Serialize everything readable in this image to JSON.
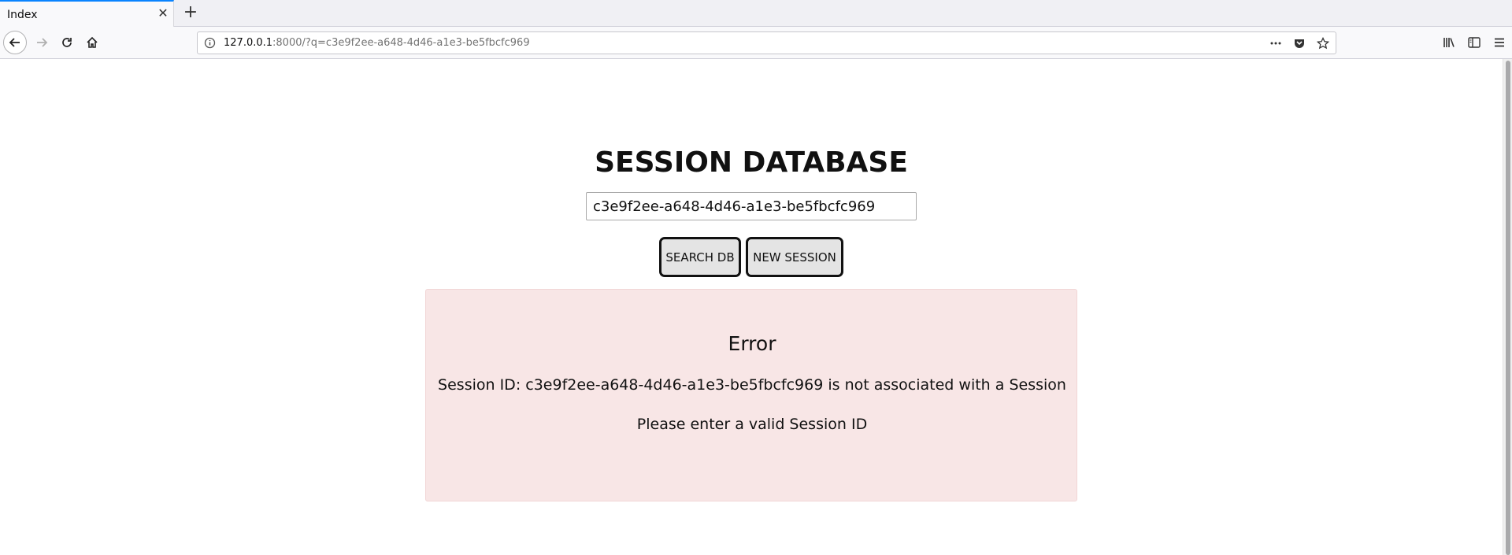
{
  "browser": {
    "tab": {
      "title": "Index",
      "close_glyph": "✕",
      "new_tab_glyph": "+"
    },
    "url": {
      "host": "127.0.0.1",
      "rest": ":8000/?q=c3e9f2ee-a648-4d46-a1e3-be5fbcfc969"
    },
    "icons": [
      "back-icon",
      "forward-icon",
      "reload-icon",
      "home-icon",
      "info-icon",
      "more-icon",
      "pocket-icon",
      "bookmark-star-icon",
      "library-icon",
      "sidebar-icon",
      "menu-icon"
    ]
  },
  "main": {
    "title": "SESSION DATABASE",
    "search": {
      "value": "c3e9f2ee-a648-4d46-a1e3-be5fbcfc969",
      "placeholder": ""
    },
    "buttons": {
      "search_label": "SEARCH DB",
      "new_session_label": "NEW SESSION"
    },
    "error": {
      "heading": "Error",
      "message": "Session ID: c3e9f2ee-a648-4d46-a1e3-be5fbcfc969 is not associated with a Session",
      "hint": "Please enter a valid Session ID"
    }
  },
  "colors": {
    "accent": "#0a84ff",
    "error_bg": "#f8e6e6",
    "button_bg": "#e4e4e4"
  }
}
